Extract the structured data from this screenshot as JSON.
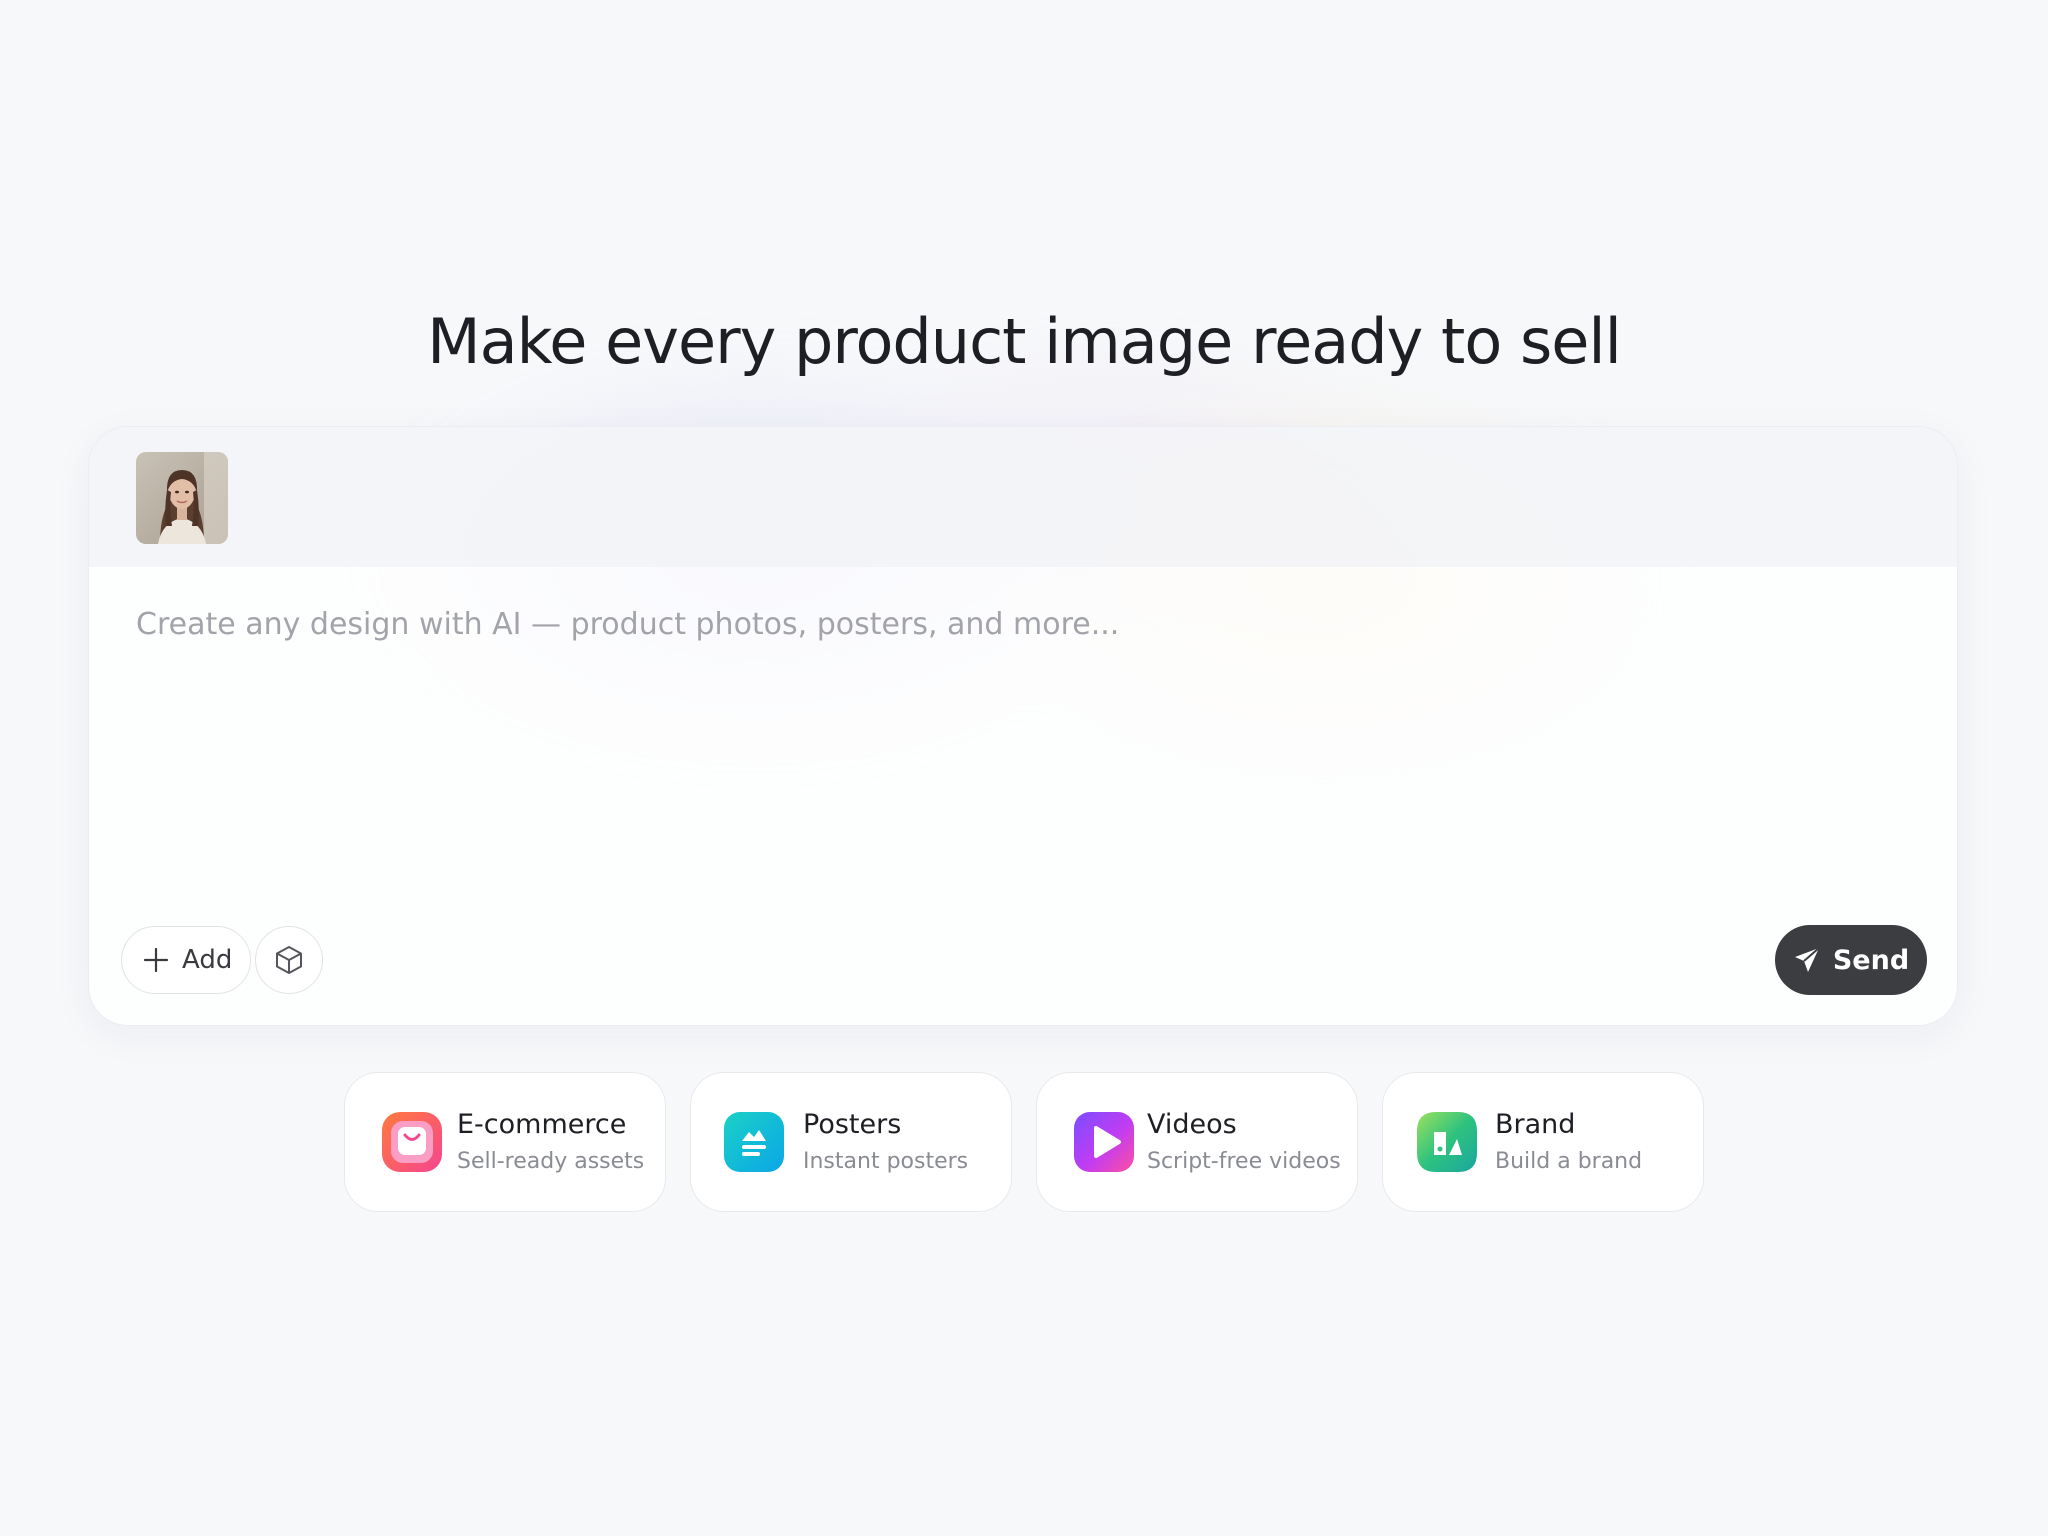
{
  "hero": {
    "title": "Make every product image ready to sell"
  },
  "composer": {
    "attachment_icon": "portrait-photo",
    "prompt_value": "",
    "prompt_placeholder": "Create any design with AI — product photos, posters, and more...",
    "add_label": "Add",
    "add_icon": "plus-icon",
    "model_icon": "cube-icon",
    "send_label": "Send",
    "send_icon": "paper-plane-icon"
  },
  "categories": [
    {
      "title": "E-commerce",
      "subtitle": "Sell-ready assets",
      "icon": "shopping-bag-icon",
      "accent": "#f0548a"
    },
    {
      "title": "Posters",
      "subtitle": "Instant posters",
      "icon": "poster-icon",
      "accent": "#12bcd6"
    },
    {
      "title": "Videos",
      "subtitle": "Script-free videos",
      "icon": "play-icon",
      "accent": "#b13cf0"
    },
    {
      "title": "Brand",
      "subtitle": "Build a brand",
      "icon": "brand-icon",
      "accent": "#3cc48a"
    }
  ],
  "colors": {
    "background": "#f7f8fa",
    "send_button": "#3c3d41",
    "title_text": "#1e1f24",
    "placeholder_text": "#a2a4aa"
  }
}
